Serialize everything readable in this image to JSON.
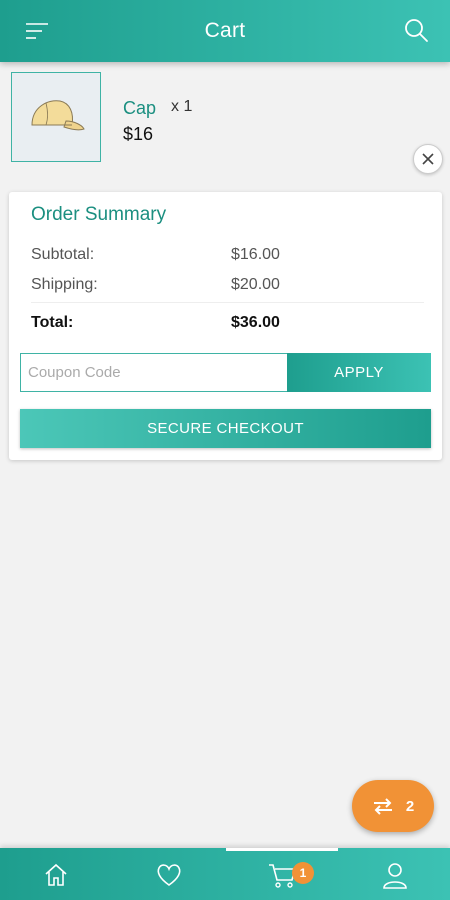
{
  "header": {
    "title": "Cart",
    "menu_icon": "menu-icon",
    "search_icon": "search-icon"
  },
  "cart": {
    "items": [
      {
        "name": "Cap",
        "quantity": "x 1",
        "price": "$16",
        "image": "cap-image"
      }
    ]
  },
  "summary": {
    "title": "Order Summary",
    "subtotal_label": "Subtotal:",
    "subtotal_value": "$16.00",
    "shipping_label": "Shipping:",
    "shipping_value": "$20.00",
    "total_label": "Total:",
    "total_value": "$36.00",
    "coupon_placeholder": "Coupon Code",
    "apply_label": "APPLY",
    "checkout_label": "SECURE CHECKOUT"
  },
  "fab": {
    "count": "2",
    "icon": "swap-arrows-icon"
  },
  "bottom_nav": {
    "items": [
      "home-icon",
      "heart-icon",
      "cart-icon",
      "user-icon"
    ],
    "cart_badge": "1",
    "active": "cart"
  },
  "colors": {
    "primary": "#1e9e8e",
    "primary_light": "#3cc2b4",
    "accent": "#f19236",
    "background": "#f2f2f2"
  }
}
